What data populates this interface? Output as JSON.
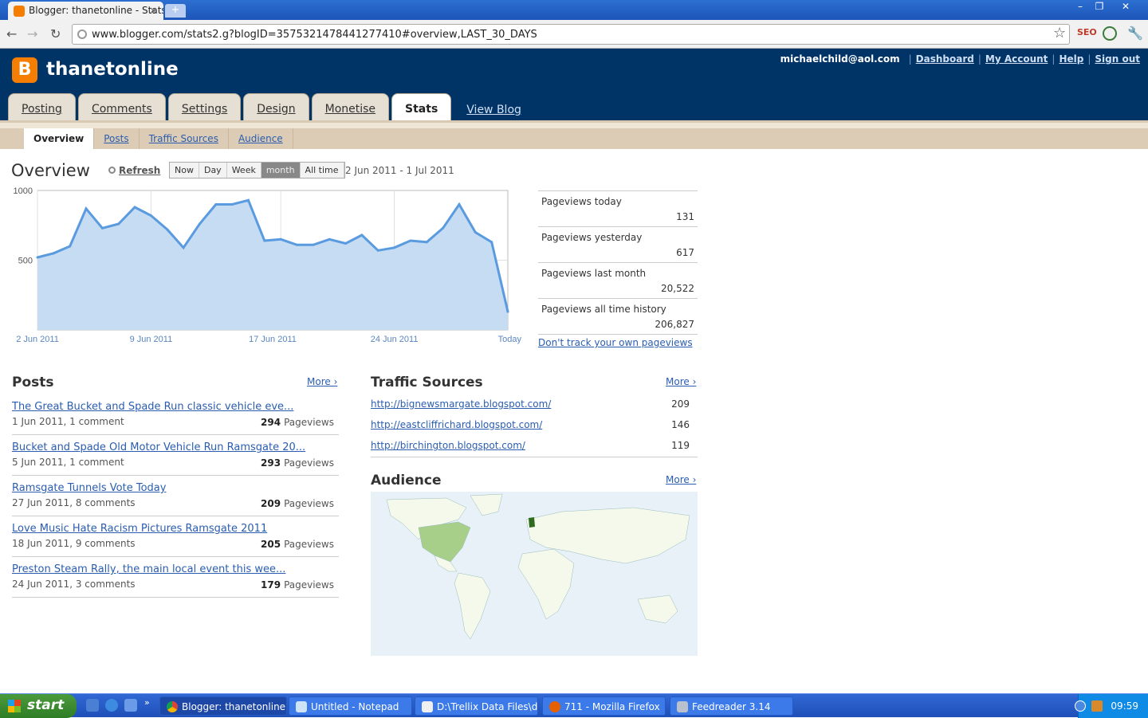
{
  "browser": {
    "tab_title": "Blogger: thanetonline - Stats",
    "url": "www.blogger.com/stats2.g?blogID=3575321478441277410#overview,LAST_30_DAYS",
    "ext_seo": "SEO"
  },
  "header": {
    "blog_name": "thanetonline",
    "email": "michaelchild@aol.com",
    "links": [
      "Dashboard",
      "My Account",
      "Help",
      "Sign out"
    ]
  },
  "tabs": [
    "Posting",
    "Comments",
    "Settings",
    "Design",
    "Monetise",
    "Stats"
  ],
  "view_blog": "View Blog",
  "subtabs": [
    "Overview",
    "Posts",
    "Traffic Sources",
    "Audience"
  ],
  "overview": {
    "title": "Overview",
    "refresh": "Refresh",
    "ranges": [
      "Now",
      "Day",
      "Week",
      "month",
      "All time"
    ],
    "selected_range": "month",
    "date_range": "2 Jun 2011 - 1 Jul 2011"
  },
  "chart_data": {
    "type": "area",
    "y_tick_labels": [
      "1000",
      "500"
    ],
    "x_tick_labels": [
      "2 Jun 2011",
      "9 Jun 2011",
      "17 Jun 2011",
      "24 Jun 2011",
      "Today"
    ],
    "ylim": [
      0,
      1000
    ],
    "values": [
      520,
      550,
      600,
      870,
      730,
      760,
      880,
      820,
      720,
      590,
      760,
      900,
      900,
      930,
      640,
      650,
      610,
      610,
      650,
      620,
      680,
      570,
      590,
      640,
      630,
      730,
      900,
      700,
      630,
      131
    ],
    "color": "#5a9be0"
  },
  "summary": [
    {
      "label": "Pageviews today",
      "value": "131"
    },
    {
      "label": "Pageviews yesterday",
      "value": "617"
    },
    {
      "label": "Pageviews last month",
      "value": "20,522"
    },
    {
      "label": "Pageviews all time history",
      "value": "206,827"
    }
  ],
  "dont_track": "Don't track your own pageviews",
  "posts": {
    "heading": "Posts",
    "more": "More ›",
    "pv_label": "Pageviews",
    "items": [
      {
        "title": "The Great Bucket and Spade Run classic vehicle eve...",
        "meta": "1 Jun 2011, 1 comment",
        "views": "294"
      },
      {
        "title": "Bucket and Spade Old Motor Vehicle Run Ramsgate 20...",
        "meta": "5 Jun 2011, 1 comment",
        "views": "293"
      },
      {
        "title": "Ramsgate Tunnels Vote Today",
        "meta": "27 Jun 2011, 8 comments",
        "views": "209"
      },
      {
        "title": "Love Music Hate Racism Pictures Ramsgate 2011",
        "meta": "18 Jun 2011, 9 comments",
        "views": "205"
      },
      {
        "title": "Preston Steam Rally, the main local event this wee...",
        "meta": "24 Jun 2011, 3 comments",
        "views": "179"
      }
    ]
  },
  "traffic": {
    "heading": "Traffic Sources",
    "more": "More ›",
    "items": [
      {
        "url": "http://bignewsmargate.blogspot.com/",
        "count": "209"
      },
      {
        "url": "http://eastcliffrichard.blogspot.com/",
        "count": "146"
      },
      {
        "url": "http://birchington.blogspot.com/",
        "count": "119"
      }
    ]
  },
  "audience": {
    "heading": "Audience",
    "more": "More ›"
  },
  "taskbar": {
    "start": "start",
    "tasks": [
      "Blogger: thanetonline...",
      "Untitled - Notepad",
      "D:\\Trellix Data Files\\d...",
      "711 - Mozilla Firefox",
      "Feedreader 3.14"
    ],
    "clock": "09:59"
  }
}
